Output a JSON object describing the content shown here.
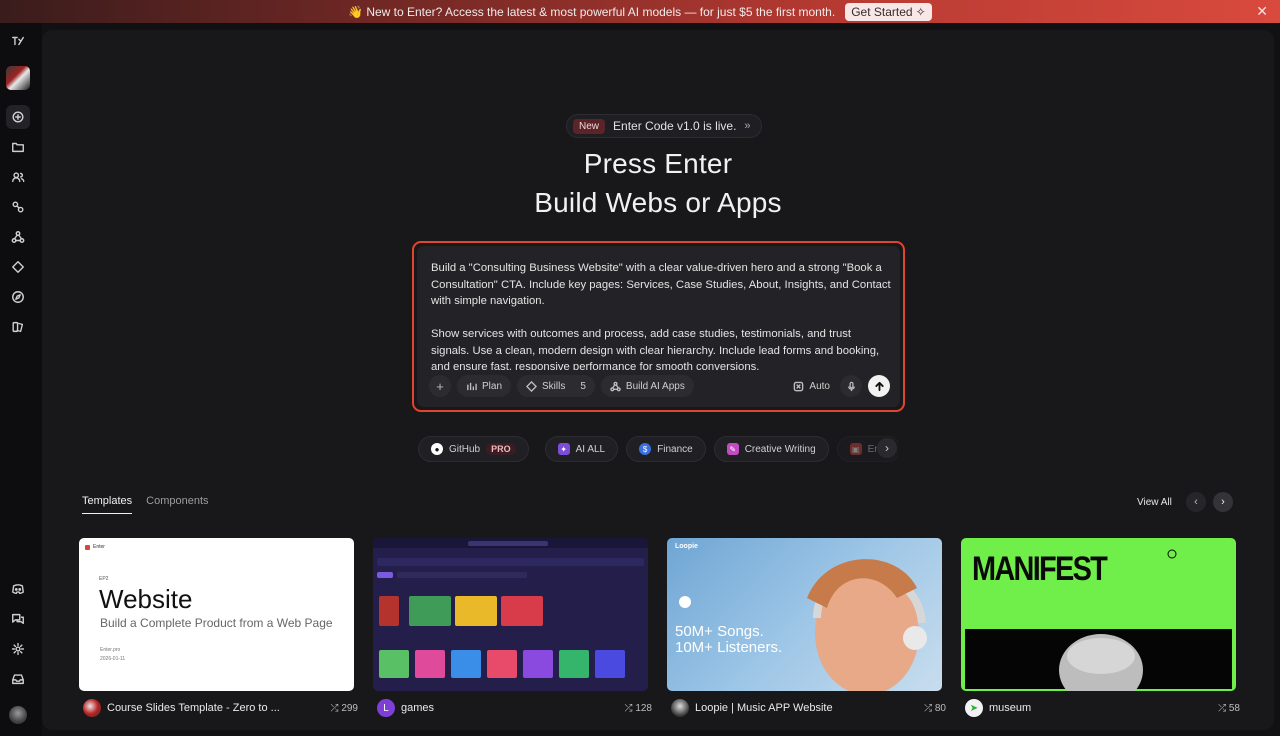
{
  "banner": {
    "wave": "👋",
    "text": "New to Enter? Access the latest & most powerful AI models — for just $5 the first month.",
    "cta": "Get Started",
    "cta_icon": "sparkle-icon",
    "close": "✕"
  },
  "announcement": {
    "tag": "New",
    "text": "Enter Code v1.0 is live.",
    "chevron": "»"
  },
  "hero": {
    "line1": "Press Enter",
    "line2": "Build Webs or Apps"
  },
  "composer": {
    "paragraph1": "Build a \"Consulting Business Website\" with a clear value-driven hero and a strong \"Book a Consultation\" CTA. Include key pages: Services, Case Studies, About, Insights, and Contact with simple navigation.",
    "paragraph2": "Show services with outcomes and process, add case studies, testimonials, and trust signals. Use a clean, modern design with clear hierarchy. Include lead forms and booking, and ensure fast, responsive performance for smooth conversions.",
    "add": "+",
    "plan": "Plan",
    "skills": "Skills",
    "skills_count": "5",
    "build_ai": "Build AI Apps",
    "auto": "Auto"
  },
  "chips": [
    {
      "label": "GitHub",
      "badge": "PRO",
      "icon": "github-icon",
      "color": "#ffffff"
    },
    {
      "label": "AI ALL",
      "icon": "ai-all-icon",
      "color": "#7c4dd6"
    },
    {
      "label": "Finance",
      "icon": "finance-icon",
      "color": "#3b6fe0"
    },
    {
      "label": "Creative Writing",
      "icon": "creative-writing-icon",
      "color": "#c44ac4"
    },
    {
      "label": "Ente",
      "icon": "enterprise-icon",
      "color": "#d4473a"
    }
  ],
  "tabs": {
    "templates": "Templates",
    "components": "Components",
    "view_all": "View All"
  },
  "cards": [
    {
      "title": "Course Slides Template - Zero to ...",
      "remix": "299",
      "avatar_letter": "",
      "preview": {
        "brand": "Enter",
        "episode": "EP2",
        "heading": "Website",
        "subheading": "Build a Complete Product from a Web Page",
        "footer1": "Enter.pro",
        "footer2": "2026-01-11"
      }
    },
    {
      "title": "games",
      "remix": "128",
      "avatar_letter": "L"
    },
    {
      "title": "Loopie | Music APP Website",
      "remix": "80",
      "avatar_letter": "",
      "preview": {
        "brand": "Loopie",
        "headline1": "50M+ Songs.",
        "headline2": "10M+ Listeners."
      }
    },
    {
      "title": "museum",
      "remix": "58",
      "avatar_letter": "",
      "preview": {
        "headline": "MANIFEST"
      }
    }
  ],
  "colors": {
    "accent": "#e0452f",
    "background": "#18181b",
    "rail": "#0d0d0f",
    "museum_green": "#70ee4a"
  }
}
